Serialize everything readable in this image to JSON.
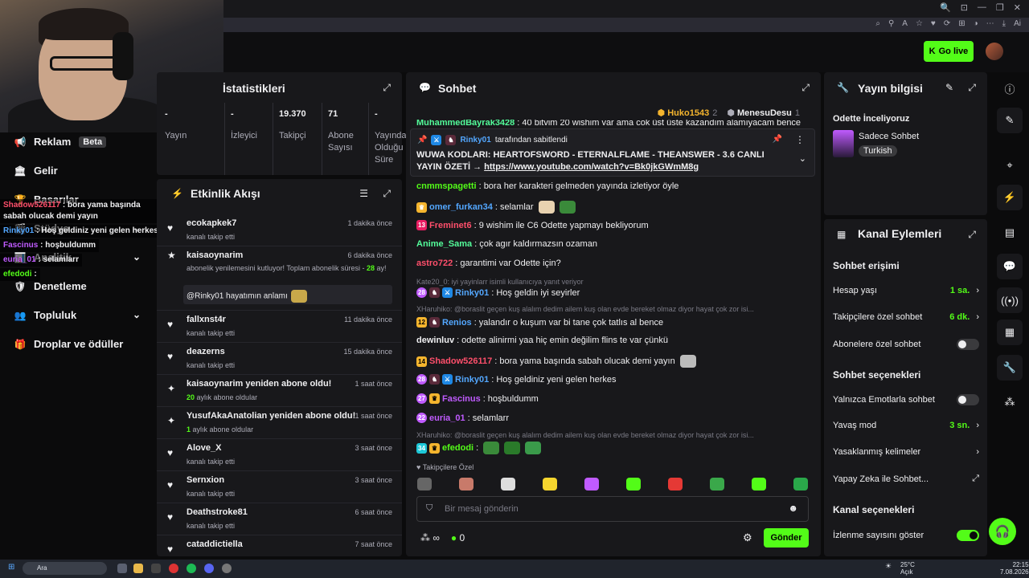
{
  "browser": {
    "top_icons": [
      "🔍",
      "⊡",
      "—",
      "❐",
      "✕"
    ],
    "bar_icons": [
      "⌕",
      "⚲",
      "A",
      "☆",
      "♥",
      "⟳",
      "⊞",
      "◑",
      "⋯",
      "⤓",
      "Ai"
    ]
  },
  "header": {
    "go_live": "Go live",
    "go_live_icon": "kick-logo-icon"
  },
  "left_nav": {
    "items": [
      {
        "label": "Reklam",
        "badge": "Beta",
        "icon": "megaphone-icon",
        "glyph": "📢"
      },
      {
        "label": "Gelir",
        "icon": "bank-icon",
        "glyph": "🏛"
      },
      {
        "label": "Başarılar",
        "icon": "trophy-icon",
        "glyph": "🏆"
      },
      {
        "label": "Stüdyo",
        "icon": "studio-icon",
        "glyph": "🎬",
        "chevron": "⌄"
      },
      {
        "label": "Analitik",
        "icon": "chart-icon",
        "glyph": "📊",
        "chevron": "⌄"
      },
      {
        "label": "Denetleme",
        "icon": "shield-icon",
        "glyph": "🛡"
      },
      {
        "label": "Topluluk",
        "icon": "people-icon",
        "glyph": "👥",
        "chevron": "⌄"
      },
      {
        "label": "Droplar ve ödüller",
        "icon": "gift-icon",
        "glyph": "🎁"
      }
    ]
  },
  "overlay_chat": [
    {
      "user": "Shadow526117",
      "text": " : bora yama başında sabah olucak demi yayın",
      "color": "#ff4f6b"
    },
    {
      "user": "Rinky01",
      "text": " : Hoş geldiniz yeni gelen herkes",
      "color": "#53a7ff"
    },
    {
      "user": "Fascinus",
      "text": " : hoşbuldumm",
      "color": "#c05bff"
    },
    {
      "user": "euria_01",
      "text": " : selamlarr",
      "color": "#c05bff"
    },
    {
      "user": "efedodi",
      "text": " :",
      "color": "#53fc18"
    }
  ],
  "stats": {
    "title": "İstatistikleri",
    "columns": [
      {
        "value": "-",
        "label": "Yayın"
      },
      {
        "value": "-",
        "label": "İzleyici"
      },
      {
        "value": "19.370",
        "label": "Takipçi"
      },
      {
        "value": "71",
        "label": "Abone Sayısı"
      },
      {
        "value": "-",
        "label": "Yayında Olduğu Süre"
      }
    ]
  },
  "activity": {
    "title": "Etkinlik Akışı",
    "items": [
      {
        "name": "ecokapkek7",
        "sub": "kanalı takip etti",
        "time": "1 dakika önce",
        "icon": "heart-icon",
        "glyph": "♥"
      },
      {
        "name": "kaisaoynarim",
        "sub": "abonelik yenilemesini kutluyor! Toplam abonelik süresi - ",
        "sub_hl": "28",
        "sub_tail": " ay!",
        "time": "6 dakika önce",
        "icon": "star-icon",
        "glyph": "★",
        "quote": "@Rinky01 hayatımın anlamı"
      },
      {
        "name": "fallxnst4r",
        "sub": "kanalı takip etti",
        "time": "11 dakika önce",
        "icon": "heart-icon",
        "glyph": "♥"
      },
      {
        "name": "deazerns",
        "sub": "kanalı takip etti",
        "time": "15 dakika önce",
        "icon": "heart-icon",
        "glyph": "♥"
      },
      {
        "name": "kaisaoynarim yeniden abone oldu!",
        "sub_hl": "20",
        "sub_tail": " aylık abone oldular",
        "time": "1 saat önce",
        "icon": "sparkle-icon",
        "glyph": "✦"
      },
      {
        "name": "YusufAkaAnatolian yeniden abone oldu!",
        "sub_hl": "1",
        "sub_tail": " aylık abone oldular",
        "time": "1 saat önce",
        "icon": "sparkle-icon",
        "glyph": "✦"
      },
      {
        "name": "Alove_X",
        "sub": "kanalı takip etti",
        "time": "3 saat önce",
        "icon": "heart-icon",
        "glyph": "♥"
      },
      {
        "name": "Sernxion",
        "sub": "kanalı takip etti",
        "time": "3 saat önce",
        "icon": "heart-icon",
        "glyph": "♥"
      },
      {
        "name": "Deathstroke81",
        "sub": "kanalı takip etti",
        "time": "6 saat önce",
        "icon": "heart-icon",
        "glyph": "♥"
      },
      {
        "name": "cataddictiella",
        "sub": "",
        "time": "7 saat önce",
        "icon": "heart-icon",
        "glyph": "♥"
      }
    ]
  },
  "chat": {
    "title": "Sohbet",
    "top_gifters": [
      {
        "name": "Huko1543",
        "count": "2"
      },
      {
        "name": "MenesuDesu",
        "count": "1"
      }
    ],
    "cut_message": {
      "user": "MuhammedBayrak3428",
      "text": ": 40 bitvim 20 wishim var ama cok üst üste kazandım alamıyacam bence"
    },
    "pinned": {
      "by_user": "Rinky01",
      "by_text": "tarafından sabitlendi",
      "text": "WUWA KODLARI: HEARTOFSWORD - ETERNALFLAME - THEANSWER - 3.6 CANLI YAYIN ÖZETİ → ",
      "link": "https://www.youtube.com/watch?v=Bk0jkGWmM8g"
    },
    "messages": [
      {
        "user": "cnmmspagetti",
        "text": ": bora her karakteri gelmeden yayında izletiyor öyle",
        "color": "#53fc18"
      },
      {
        "user": "omer_furkan34",
        "text": ": selamlar",
        "color": "#53a7ff",
        "badge": "crown"
      },
      {
        "user": "Freminet6",
        "text": ": 9 wishim ile C6 Odette yapmayı bekliyorum",
        "color": "#ff4f6b",
        "badge": "sub-13"
      },
      {
        "user": "Anime_Sama",
        "text": ": çok agır kaldırmazsın ozaman",
        "color": "#53fc9a"
      },
      {
        "user": "astro722",
        "text": ": garantimi var Odette için?",
        "color": "#ff4f6b"
      },
      {
        "reply": "Kate20_0: iyi yayinlarr isimli kullanıcıya yanıt veriyor"
      },
      {
        "user": "Rinky01",
        "text": ": Hoş geldin iyi seyirler",
        "color": "#53a7ff",
        "badge": "mod-28"
      },
      {
        "reply": "XHaruhiko: @boraslit geçen kuş alalım dedim ailem kuş olan evde bereket olmaz diyor hayat çok zor  isi..."
      },
      {
        "user": "Renios",
        "text": ": yalandır o kuşum var bi tane çok tatlıs al bence",
        "color": "#53a7ff",
        "badge": "sub-12"
      },
      {
        "user": "dewinluv",
        "text": ": odette alinirmi yaa hiç emin değilim flins te var çünkü",
        "color": "#efeff1"
      },
      {
        "user": "Shadow526117",
        "text": ": bora yama başında sabah olucak demi yayın",
        "color": "#ff4f6b",
        "badge": "sub-14"
      },
      {
        "user": "Rinky01",
        "text": ": Hoş geldiniz yeni gelen herkes",
        "color": "#53a7ff",
        "badge": "mod-28"
      },
      {
        "user": "Fascinus",
        "text": ": hoşbuldumm",
        "color": "#c05bff",
        "badge": "sub-27"
      },
      {
        "user": "euria_01",
        "text": ": selamlarr",
        "color": "#c05bff",
        "badge": "sub-22"
      },
      {
        "reply": "XHaruhiko: @boraslit geçen kuş alalım dedim ailem kuş olan evde bereket olmaz diyor hayat çok zor  isi..."
      },
      {
        "user": "efedodi",
        "text": ":",
        "color": "#53fc18",
        "badge": "sub-34"
      }
    ],
    "emote_section": "Takipçilere Özel",
    "input_placeholder": "Bir mesaj gönderin",
    "points": "0",
    "infinity": "∞",
    "send": "Gönder"
  },
  "stream_info": {
    "title": "Yayın bilgisi",
    "stream_title": "Odette İnceliyoruz",
    "category": "Sadece Sohbet",
    "tag": "Turkish"
  },
  "channel_actions": {
    "title": "Kanal Eylemleri",
    "chat_access": "Sohbet erişimi",
    "rows_access": [
      {
        "label": "Hesap yaşı",
        "value": "1 sa.",
        "type": "arrow"
      },
      {
        "label": "Takipçilere özel sohbet",
        "value": "6 dk.",
        "type": "arrow"
      },
      {
        "label": "Abonelere özel sohbet",
        "type": "toggle",
        "on": false
      }
    ],
    "chat_options": "Sohbet seçenekleri",
    "rows_options": [
      {
        "label": "Yalnızca Emotlarla sohbet",
        "type": "toggle",
        "on": false
      },
      {
        "label": "Yavaş mod",
        "value": "3 sn.",
        "type": "arrow"
      },
      {
        "label": "Yasaklanmış kelimeler",
        "type": "arrow"
      },
      {
        "label": "Yapay Zeka ile Sohbet...",
        "type": "external"
      }
    ],
    "channel_options": "Kanal seçenekleri",
    "rows_channel": [
      {
        "label": "İzlenme sayısını göster",
        "type": "toggle",
        "on": true
      }
    ]
  },
  "taskbar": {
    "search": "Ara",
    "weather": "25°C",
    "weather_sub": "Açık",
    "time": "22:15",
    "date": "7.08.2026"
  },
  "colors": {
    "accent": "#53fc18",
    "panel": "#18181b",
    "bg": "#0b0b0c"
  }
}
